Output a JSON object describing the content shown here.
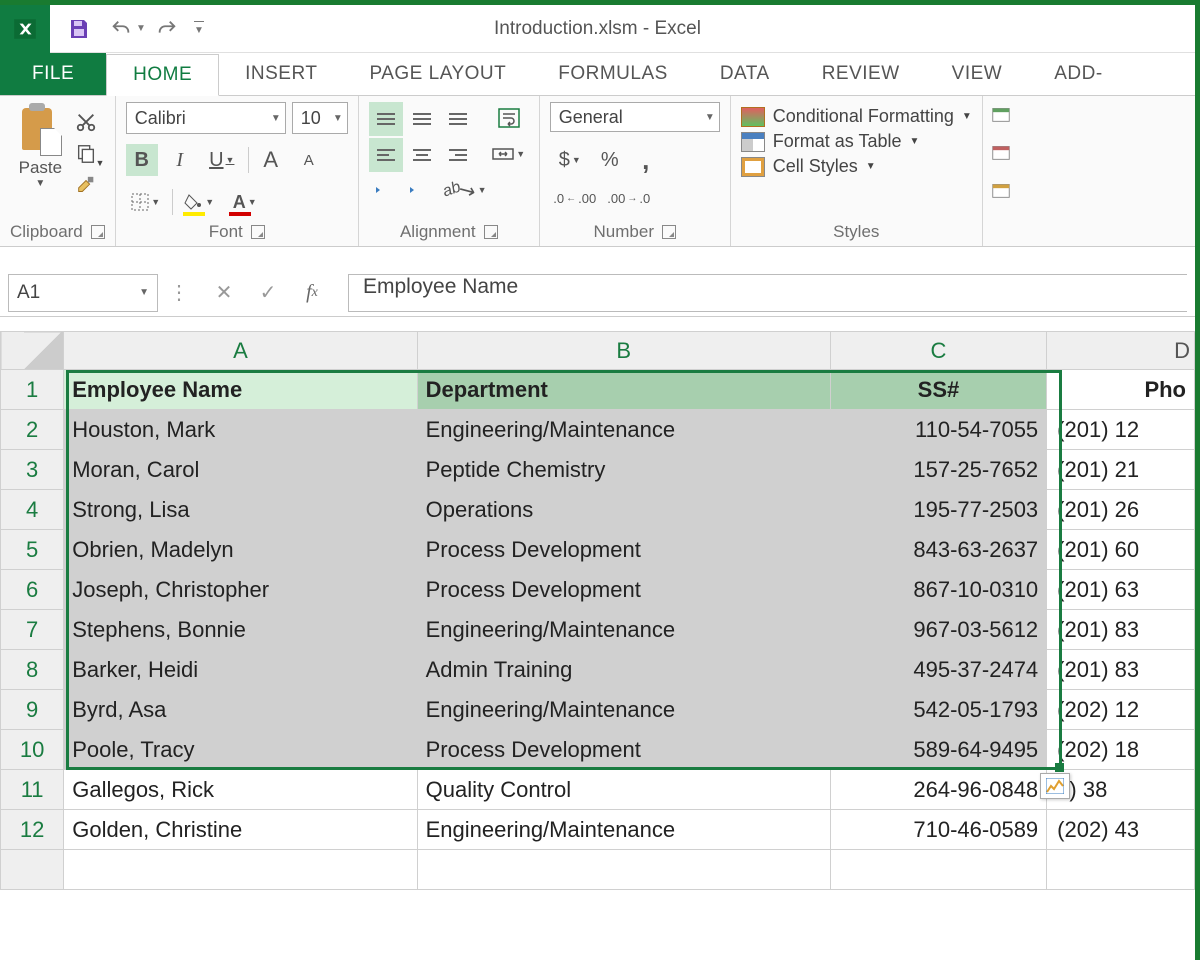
{
  "title": "Introduction.xlsm - Excel",
  "qat": {
    "save": "Save",
    "undo": "Undo",
    "redo": "Redo"
  },
  "tabs": [
    "FILE",
    "HOME",
    "INSERT",
    "PAGE LAYOUT",
    "FORMULAS",
    "DATA",
    "REVIEW",
    "VIEW",
    "ADD-"
  ],
  "active_tab": "HOME",
  "ribbon": {
    "clipboard": {
      "label": "Clipboard",
      "paste": "Paste"
    },
    "font": {
      "label": "Font",
      "name": "Calibri",
      "size": "10",
      "bold": "B",
      "italic": "I",
      "underline": "U",
      "growA": "A",
      "shrinkA": "A"
    },
    "alignment": {
      "label": "Alignment"
    },
    "number": {
      "label": "Number",
      "format": "General",
      "currency": "$",
      "percent": "%",
      "comma": ",",
      "inc": ".0 .00",
      "dec": ".00 .0"
    },
    "styles": {
      "label": "Styles",
      "conditional": "Conditional Formatting",
      "table": "Format as Table",
      "cell": "Cell Styles"
    }
  },
  "name_box": "A1",
  "formula_value": "Employee Name",
  "columns": [
    "A",
    "B",
    "C",
    "D"
  ],
  "headers": [
    "Employee Name",
    "Department",
    "SS#",
    "Pho"
  ],
  "rows": [
    {
      "n": 2,
      "a": "Houston, Mark",
      "b": "Engineering/Maintenance",
      "c": "110-54-7055",
      "d": "(201) 12"
    },
    {
      "n": 3,
      "a": "Moran, Carol",
      "b": "Peptide Chemistry",
      "c": "157-25-7652",
      "d": "(201) 21"
    },
    {
      "n": 4,
      "a": "Strong, Lisa",
      "b": "Operations",
      "c": "195-77-2503",
      "d": "(201) 26"
    },
    {
      "n": 5,
      "a": "Obrien, Madelyn",
      "b": "Process Development",
      "c": "843-63-2637",
      "d": "(201) 60"
    },
    {
      "n": 6,
      "a": "Joseph, Christopher",
      "b": "Process Development",
      "c": "867-10-0310",
      "d": "(201) 63"
    },
    {
      "n": 7,
      "a": "Stephens, Bonnie",
      "b": "Engineering/Maintenance",
      "c": "967-03-5612",
      "d": "(201) 83"
    },
    {
      "n": 8,
      "a": "Barker, Heidi",
      "b": "Admin Training",
      "c": "495-37-2474",
      "d": "(201) 83"
    },
    {
      "n": 9,
      "a": "Byrd, Asa",
      "b": "Engineering/Maintenance",
      "c": "542-05-1793",
      "d": "(202) 12"
    },
    {
      "n": 10,
      "a": "Poole, Tracy",
      "b": "Process Development",
      "c": "589-64-9495",
      "d": "(202) 18"
    },
    {
      "n": 11,
      "a": "Gallegos, Rick",
      "b": "Quality Control",
      "c": "264-96-0848",
      "d": "2) 38"
    },
    {
      "n": 12,
      "a": "Golden, Christine",
      "b": "Engineering/Maintenance",
      "c": "710-46-0589",
      "d": "(202) 43"
    }
  ],
  "selection": {
    "range": "A1:C10"
  }
}
